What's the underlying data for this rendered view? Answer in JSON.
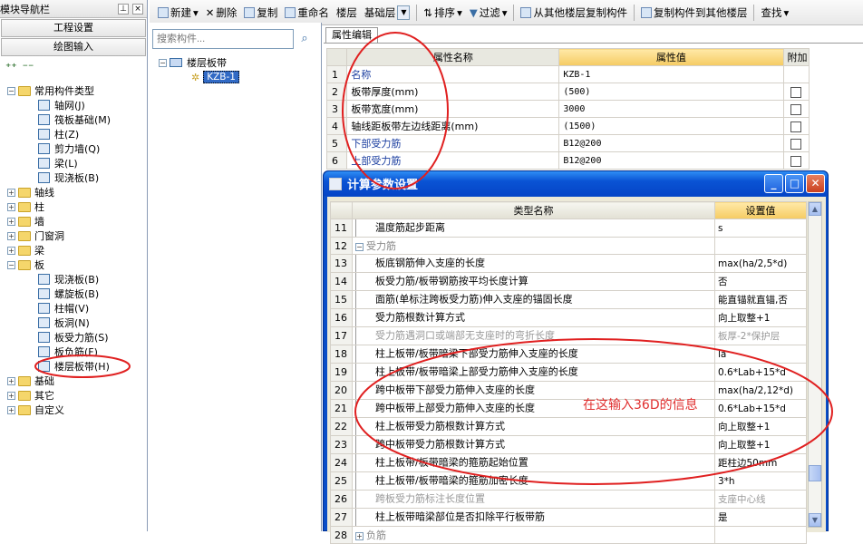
{
  "left_panel": {
    "title": "模块导航栏",
    "pin_glyph": "⊥",
    "close_glyph": "×",
    "project_settings": "工程设置",
    "drawing_input": "绘图输入",
    "tree": [
      {
        "label": "常用构件类型",
        "expander": "−",
        "level": 0,
        "kind": "folder"
      },
      {
        "label": "轴网(J)",
        "level": 1,
        "kind": "item"
      },
      {
        "label": "筏板基础(M)",
        "level": 1,
        "kind": "item"
      },
      {
        "label": "柱(Z)",
        "level": 1,
        "kind": "item"
      },
      {
        "label": "剪力墙(Q)",
        "level": 1,
        "kind": "item"
      },
      {
        "label": "梁(L)",
        "level": 1,
        "kind": "item"
      },
      {
        "label": "现浇板(B)",
        "level": 1,
        "kind": "item"
      },
      {
        "label": "轴线",
        "expander": "+",
        "level": 0,
        "kind": "folder"
      },
      {
        "label": "柱",
        "expander": "+",
        "level": 0,
        "kind": "folder"
      },
      {
        "label": "墙",
        "expander": "+",
        "level": 0,
        "kind": "folder"
      },
      {
        "label": "门窗洞",
        "expander": "+",
        "level": 0,
        "kind": "folder"
      },
      {
        "label": "梁",
        "expander": "+",
        "level": 0,
        "kind": "folder"
      },
      {
        "label": "板",
        "expander": "−",
        "level": 0,
        "kind": "folder"
      },
      {
        "label": "现浇板(B)",
        "level": 1,
        "kind": "item"
      },
      {
        "label": "螺旋板(B)",
        "level": 1,
        "kind": "item"
      },
      {
        "label": "柱帽(V)",
        "level": 1,
        "kind": "item"
      },
      {
        "label": "板洞(N)",
        "level": 1,
        "kind": "item"
      },
      {
        "label": "板受力筋(S)",
        "level": 1,
        "kind": "item"
      },
      {
        "label": "板负筋(F)",
        "level": 1,
        "kind": "item"
      },
      {
        "label": "楼层板带(H)",
        "level": 1,
        "kind": "item"
      },
      {
        "label": "基础",
        "expander": "+",
        "level": 0,
        "kind": "folder"
      },
      {
        "label": "其它",
        "expander": "+",
        "level": 0,
        "kind": "folder"
      },
      {
        "label": "自定义",
        "expander": "+",
        "level": 0,
        "kind": "folder"
      }
    ]
  },
  "toolbar": {
    "new": "新建",
    "delete": "删除",
    "copy": "复制",
    "rename": "重命名",
    "floor": "楼层",
    "floor_value": "基础层",
    "sort": "排序",
    "filter": "过滤",
    "copy_from_other": "从其他楼层复制构件",
    "copy_to_other": "复制构件到其他楼层",
    "find": "查找"
  },
  "component_list": {
    "search_placeholder": "搜索构件...",
    "group_label": "楼层板带",
    "expander": "−",
    "selected_item": "KZB-1"
  },
  "property_tab": "属性编辑",
  "property_table": {
    "headers": [
      "属性名称",
      "属性值",
      "附加"
    ],
    "rows": [
      {
        "n": "1",
        "name": "名称",
        "value": "KZB-1",
        "blue": true,
        "check": false
      },
      {
        "n": "2",
        "name": "板带厚度(mm)",
        "value": "(500)",
        "blue": false,
        "check": true
      },
      {
        "n": "3",
        "name": "板带宽度(mm)",
        "value": "3000",
        "blue": false,
        "check": true
      },
      {
        "n": "4",
        "name": "轴线距板带左边线距离(mm)",
        "value": "(1500)",
        "blue": false,
        "check": true
      },
      {
        "n": "5",
        "name": "下部受力筋",
        "value": "B12@200",
        "blue": true,
        "check": true
      },
      {
        "n": "6",
        "name": "上部受力筋",
        "value": "B12@200",
        "blue": true,
        "check": true
      }
    ]
  },
  "dialog": {
    "title": "计算参数设置",
    "headers": [
      "类型名称",
      "设置值"
    ],
    "rows": [
      {
        "n": "11",
        "name": "温度筋起步距离",
        "value": "s",
        "style": "child"
      },
      {
        "n": "12",
        "name": "受力筋",
        "value": "",
        "style": "group",
        "exp": "−"
      },
      {
        "n": "13",
        "name": "板底钢筋伸入支座的长度",
        "value": "max(ha/2,5*d)",
        "style": "child"
      },
      {
        "n": "14",
        "name": "板受力筋/板带钢筋按平均长度计算",
        "value": "否",
        "style": "child"
      },
      {
        "n": "15",
        "name": "面筋(单标注跨板受力筋)伸入支座的锚固长度",
        "value": "能直锚就直锚,否",
        "style": "child"
      },
      {
        "n": "16",
        "name": "受力筋根数计算方式",
        "value": "向上取整+1",
        "style": "child"
      },
      {
        "n": "17",
        "name": "受力筋遇洞口或端部无支座时的弯折长度",
        "value": "板厚-2*保护层",
        "style": "gray"
      },
      {
        "n": "18",
        "name": "柱上板带/板带暗梁下部受力筋伸入支座的长度",
        "value": "la",
        "style": "child"
      },
      {
        "n": "19",
        "name": "柱上板带/板带暗梁上部受力筋伸入支座的长度",
        "value": "0.6*Lab+15*d",
        "style": "child"
      },
      {
        "n": "20",
        "name": "跨中板带下部受力筋伸入支座的长度",
        "value": "max(ha/2,12*d)",
        "style": "child"
      },
      {
        "n": "21",
        "name": "跨中板带上部受力筋伸入支座的长度",
        "value": "0.6*Lab+15*d",
        "style": "child"
      },
      {
        "n": "22",
        "name": "柱上板带受力筋根数计算方式",
        "value": "向上取整+1",
        "style": "child"
      },
      {
        "n": "23",
        "name": "跨中板带受力筋根数计算方式",
        "value": "向上取整+1",
        "style": "child"
      },
      {
        "n": "24",
        "name": "柱上板带/板带暗梁的箍筋起始位置",
        "value": "距柱边50mm",
        "style": "child"
      },
      {
        "n": "25",
        "name": "柱上板带/板带暗梁的箍筋加密长度",
        "value": "3*h",
        "style": "child"
      },
      {
        "n": "26",
        "name": "跨板受力筋标注长度位置",
        "value": "支座中心线",
        "style": "gray"
      },
      {
        "n": "27",
        "name": "柱上板带暗梁部位是否扣除平行板带筋",
        "value": "是",
        "style": "child"
      },
      {
        "n": "28",
        "name": "负筋",
        "value": "",
        "style": "group",
        "exp": "+"
      }
    ]
  },
  "annotation": "在这输入36D的信息",
  "colors": {
    "annotation": "#e03030",
    "selected_item_bg": "#316ac5",
    "dialog_title": "#0a53d4"
  }
}
